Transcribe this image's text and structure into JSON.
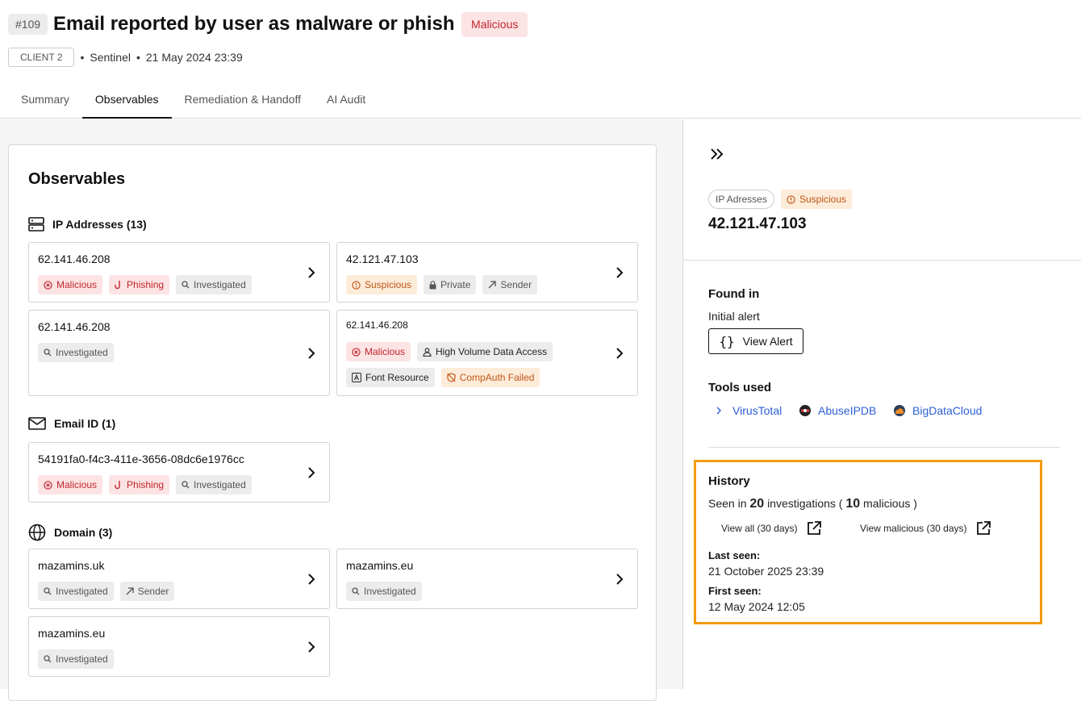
{
  "header": {
    "id_tag": "#109",
    "title": "Email reported by user as malware or phish",
    "verdict": "Malicious",
    "client": "CLIENT 2",
    "source": "Sentinel",
    "datetime": "21 May 2024 23:39"
  },
  "tabs": [
    "Summary",
    "Observables",
    "Remediation & Handoff",
    "AI Audit"
  ],
  "active_tab": "Observables",
  "observables": {
    "title": "Observables",
    "ip_section": "IP Addresses (13)",
    "ip_items": [
      {
        "value": "62.141.46.208",
        "tags": [
          "Malicious",
          "Phishing",
          "Investigated"
        ]
      },
      {
        "value": "42.121.47.103",
        "tags": [
          "Suspicious",
          "Private",
          "Sender"
        ]
      },
      {
        "value": "62.141.46.208",
        "tags": [
          "Investigated"
        ]
      },
      {
        "value": "62.141.46.208",
        "tags": [
          "Malicious",
          "High Volume Data Access",
          "Font Resource",
          "CompAuth Failed"
        ]
      }
    ],
    "email_section": "Email ID (1)",
    "email_items": [
      {
        "value": "54191fa0-f4c3-411e-3656-08dc6e1976cc",
        "tags": [
          "Malicious",
          "Phishing",
          "Investigated"
        ]
      }
    ],
    "domain_section": "Domain (3)",
    "domain_items": [
      {
        "value": "mazamins.uk",
        "tags": [
          "Investigated",
          "Sender"
        ]
      },
      {
        "value": "mazamins.eu",
        "tags": [
          "Investigated"
        ]
      },
      {
        "value": "mazamins.eu",
        "tags": [
          "Investigated"
        ]
      }
    ]
  },
  "detail": {
    "type": "IP Adresses",
    "verdict": "Suspicious",
    "value": "42.121.47.103",
    "found_in_label": "Found in",
    "found_in_value": "Initial alert",
    "view_alert": "View Alert",
    "tools_label": "Tools used",
    "tools": [
      "VirusTotal",
      "AbuseIPDB",
      "BigDataCloud"
    ],
    "history": {
      "label": "History",
      "seen_prefix": "Seen in",
      "investigations_count": "20",
      "investigations_mid": "investigations (",
      "malicious_count": "10",
      "malicious_suffix": "malicious )",
      "view_all": "View all (30 days)",
      "view_malicious": "View malicious (30 days)",
      "last_seen_label": "Last seen:",
      "last_seen": "21 October 2025 23:39",
      "first_seen_label": "First seen:",
      "first_seen": "12 May 2024 12:05"
    }
  },
  "colors": {
    "malicious": "#c0262d",
    "suspicious": "#c0561a",
    "link": "#2d5fd6",
    "highlight": "#f29a12"
  }
}
